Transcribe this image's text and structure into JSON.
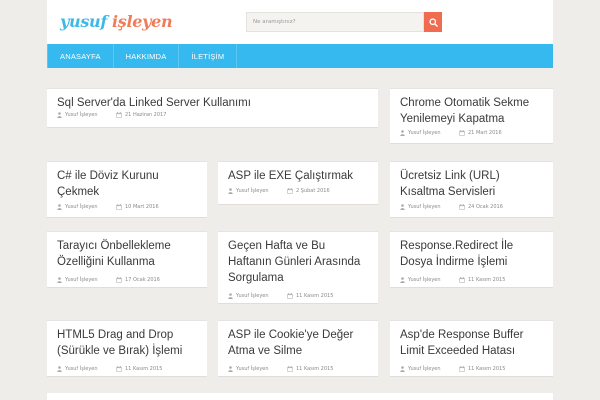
{
  "site": {
    "logo_word1": "yusuf",
    "logo_word2": "işleyen"
  },
  "search": {
    "placeholder": "Ne aramıştınız?"
  },
  "nav": {
    "items": [
      {
        "label": "ANASAYFA"
      },
      {
        "label": "HAKKIMDA"
      },
      {
        "label": "İLETİŞİM"
      }
    ]
  },
  "posts": [
    {
      "title": "Sql Server'da Linked Server Kullanımı",
      "author": "Yusuf İşleyen",
      "date": "21 Haziran 2017"
    },
    {
      "title": "Chrome Otomatik Sekme Yenilemeyi Kapatma",
      "author": "Yusuf İşleyen",
      "date": "21 Mart 2016"
    },
    {
      "title": "C# ile Döviz Kurunu Çekmek",
      "author": "Yusuf İşleyen",
      "date": "10 Mart 2016"
    },
    {
      "title": "ASP ile EXE Çalıştırmak",
      "author": "Yusuf İşleyen",
      "date": "2 Şubat 2016"
    },
    {
      "title": "Ücretsiz Link (URL) Kısaltma Servisleri",
      "author": "Yusuf İşleyen",
      "date": "24 Ocak 2016"
    },
    {
      "title": "Tarayıcı Önbellekleme Özelliğini Kullanma",
      "author": "Yusuf İşleyen",
      "date": "17 Ocak 2016"
    },
    {
      "title": "Geçen Hafta ve Bu Haftanın Günleri Arasında Sorgulama",
      "author": "Yusuf İşleyen",
      "date": "11 Kasım 2015"
    },
    {
      "title": "Response.Redirect İle Dosya İndirme İşlemi",
      "author": "Yusuf İşleyen",
      "date": "11 Kasım 2015"
    },
    {
      "title": "HTML5 Drag and Drop (Sürükle ve Bırak) İşlemi",
      "author": "Yusuf İşleyen",
      "date": "11 Kasım 2015"
    },
    {
      "title": "ASP ile Cookie'ye Değer Atma ve Silme",
      "author": "Yusuf İşleyen",
      "date": "11 Kasım 2015"
    },
    {
      "title": "Asp'de Response Buffer Limit Exceeded Hatası",
      "author": "Yusuf İşleyen",
      "date": "11 Kasım 2015"
    }
  ]
}
